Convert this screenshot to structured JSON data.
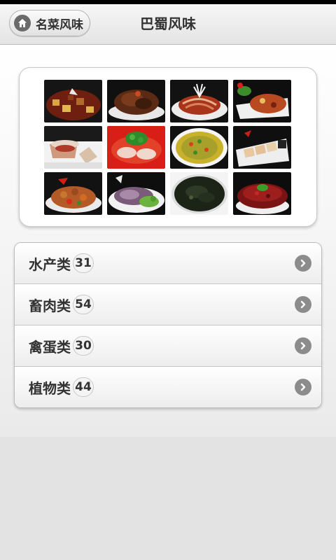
{
  "header": {
    "back_label": "名菜风味",
    "title": "巴蜀风味"
  },
  "icons": {
    "back": "home-icon",
    "row": "chevron-right-icon"
  },
  "dish_grid": {
    "tiles": [
      {
        "subject": "braised meat with potatoes"
      },
      {
        "subject": "sliced braised meat"
      },
      {
        "subject": "shredded dish with herbs"
      },
      {
        "subject": "stir-fried meat with chili"
      },
      {
        "subject": "dessert in glass"
      },
      {
        "subject": "sliced meat in red chili oil"
      },
      {
        "subject": "fish in green pepper soup"
      },
      {
        "subject": "rolled sliced meat"
      },
      {
        "subject": "diced chicken with peppers"
      },
      {
        "subject": "sliced duck with greens"
      },
      {
        "subject": "seaweed egg soup"
      },
      {
        "subject": "minced meat in red sauce"
      }
    ]
  },
  "categories": [
    {
      "label": "水产类",
      "count": "31"
    },
    {
      "label": "畜肉类",
      "count": "54"
    },
    {
      "label": "禽蛋类",
      "count": "30"
    },
    {
      "label": "植物类",
      "count": "44"
    }
  ],
  "colors": {
    "header_bg": "#ececec",
    "text": "#333333",
    "chevron": "#8c8c8c",
    "home_icon": "#6b6b6b"
  }
}
